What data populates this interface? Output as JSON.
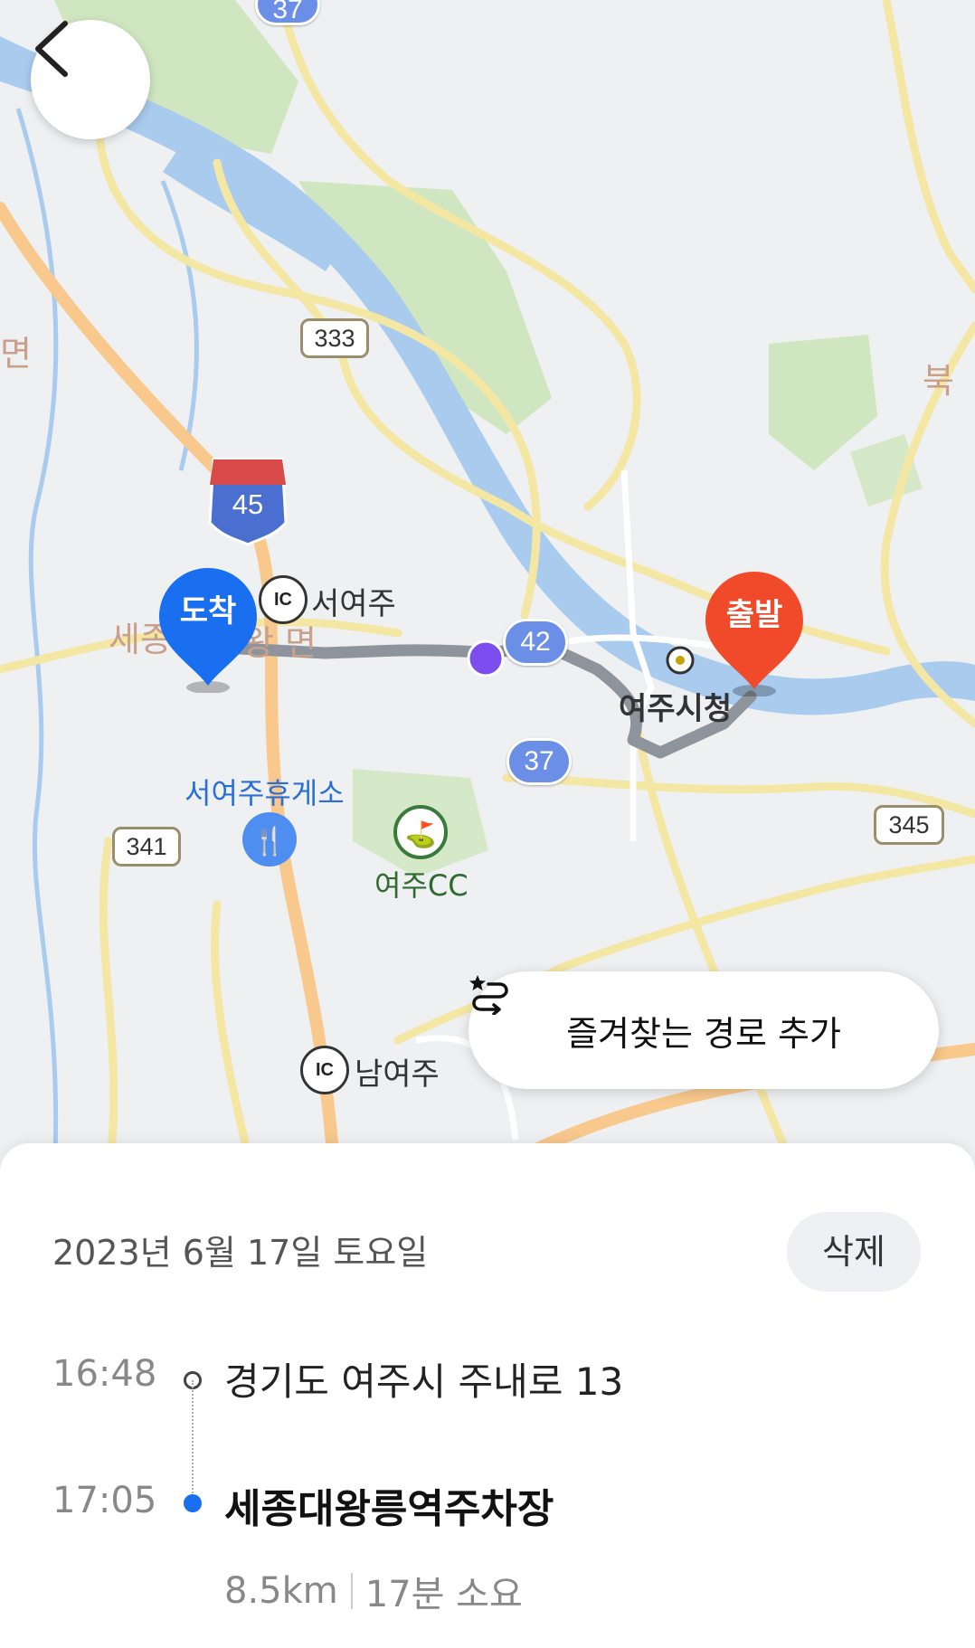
{
  "map": {
    "area_labels": [
      "면",
      "북",
      "세종",
      "왕 면"
    ],
    "places": {
      "ic_label": "IC",
      "seoyeoju_ic": "서여주",
      "namyeoju_ic": "남여주",
      "rest_area": "서여주휴게소",
      "golf": "여주CC",
      "city_hall": "여주시청"
    },
    "routes": {
      "r333": "333",
      "r45": "45",
      "r42": "42",
      "r37": "37",
      "r341": "341",
      "r345": "345",
      "r37_top": "37"
    },
    "pins": {
      "start": "출발",
      "end": "도착"
    },
    "colors": {
      "start_pin": "#f04a2a",
      "end_pin": "#1a6ef0",
      "route_line": "#8e949c",
      "river": "#a9cbee"
    }
  },
  "fav_button": {
    "label": "즐겨찾는 경로 추가"
  },
  "trip": {
    "date": "2023년 6월 17일 토요일",
    "delete_label": "삭제",
    "start_time": "16:48",
    "start_address": "경기도 여주시 주내로 13",
    "end_time": "17:05",
    "end_name": "세종대왕릉역주차장",
    "distance": "8.5km",
    "duration": "17분 소요"
  }
}
